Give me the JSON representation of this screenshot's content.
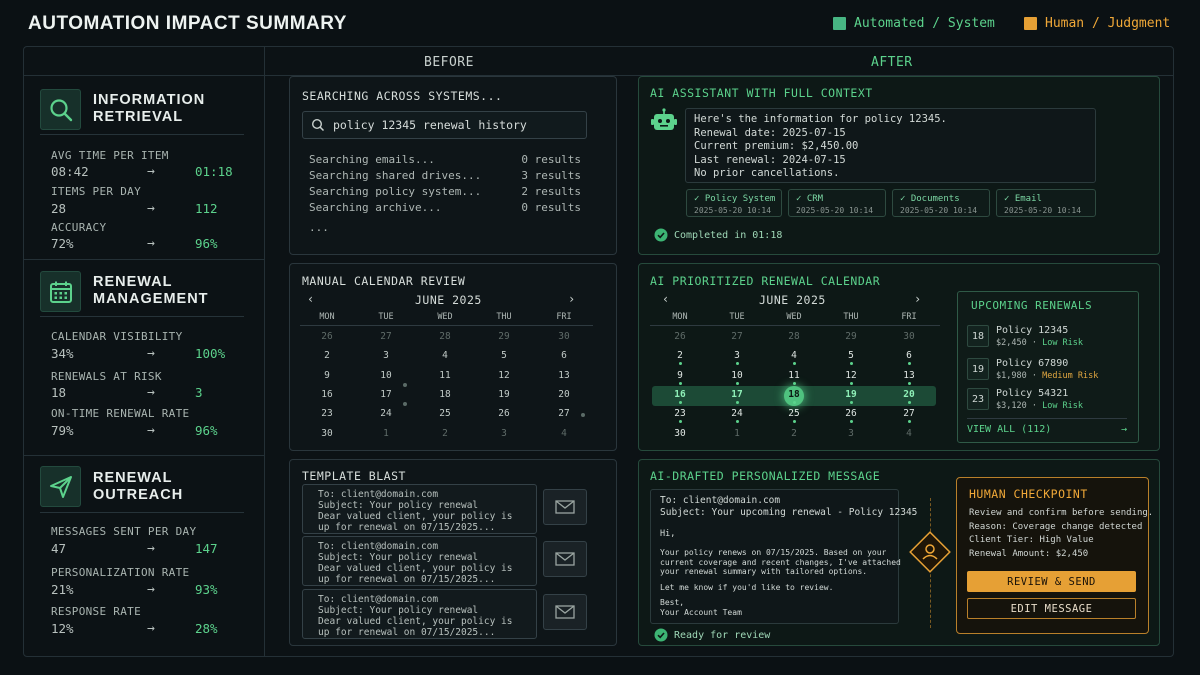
{
  "title": "AUTOMATION IMPACT SUMMARY",
  "legend": [
    {
      "label": "Automated / System",
      "color": "#47b583"
    },
    {
      "label": "Human / Judgment",
      "color": "#e6a035"
    }
  ],
  "columns": {
    "before": "BEFORE",
    "after": "AFTER"
  },
  "sections": [
    {
      "title_line1": "INFORMATION",
      "title_line2": "RETRIEVAL",
      "icon": "magnifier-icon",
      "metrics": [
        {
          "label": "AVG TIME PER ITEM",
          "before": "08:42",
          "after": "01:18"
        },
        {
          "label": "ITEMS PER DAY",
          "before": "28",
          "after": "112"
        },
        {
          "label": "ACCURACY",
          "before": "72%",
          "after": "96%"
        }
      ]
    },
    {
      "title_line1": "RENEWAL",
      "title_line2": "MANAGEMENT",
      "icon": "calendar-icon",
      "metrics": [
        {
          "label": "CALENDAR VISIBILITY",
          "before": "34%",
          "after": "100%"
        },
        {
          "label": "RENEWALS AT RISK",
          "before": "18",
          "after": "3"
        },
        {
          "label": "ON-TIME RENEWAL RATE",
          "before": "79%",
          "after": "96%"
        }
      ]
    },
    {
      "title_line1": "RENEWAL",
      "title_line2": "OUTREACH",
      "icon": "paper-plane-icon",
      "metrics": [
        {
          "label": "MESSAGES SENT PER DAY",
          "before": "47",
          "after": "147"
        },
        {
          "label": "PERSONALIZATION RATE",
          "before": "21%",
          "after": "93%"
        },
        {
          "label": "RESPONSE RATE",
          "before": "12%",
          "after": "28%"
        }
      ]
    }
  ],
  "arrow": "→",
  "search_panel": {
    "title": "SEARCHING ACROSS SYSTEMS...",
    "query": "policy 12345 renewal history",
    "rows": [
      {
        "label": "Searching emails...",
        "result": "0 results"
      },
      {
        "label": "Searching shared drives...",
        "result": "3 results"
      },
      {
        "label": "Searching policy system...",
        "result": "2 results"
      },
      {
        "label": "Searching archive...",
        "result": "0 results"
      }
    ],
    "ellipsis": "..."
  },
  "assistant_panel": {
    "title": "AI ASSISTANT WITH FULL CONTEXT",
    "lines": [
      "Here's the information for policy 12345.",
      "Renewal date: 2025-07-15",
      "Current premium: $2,450.00",
      "Last renewal: 2024-07-15",
      "No prior cancellations."
    ],
    "sources": [
      {
        "name": "Policy System",
        "time": "2025-05-20 10:14"
      },
      {
        "name": "CRM",
        "time": "2025-05-20 10:14"
      },
      {
        "name": "Documents",
        "time": "2025-05-20 10:14"
      },
      {
        "name": "Email",
        "time": "2025-05-20 10:14"
      }
    ],
    "status": "Completed in 01:18"
  },
  "manual_calendar": {
    "title": "MANUAL CALENDAR REVIEW",
    "month": "JUNE 2025",
    "days": [
      "MON",
      "TUE",
      "WED",
      "THU",
      "FRI"
    ],
    "weeks": [
      [
        "26",
        "27",
        "28",
        "29",
        "30"
      ],
      [
        "2",
        "3",
        "4",
        "5",
        "6"
      ],
      [
        "9",
        "10",
        "11",
        "12",
        "13"
      ],
      [
        "16",
        "17",
        "18",
        "19",
        "20"
      ],
      [
        "23",
        "24",
        "25",
        "26",
        "27"
      ],
      [
        "30",
        "1",
        "2",
        "3",
        "4"
      ]
    ]
  },
  "ai_calendar": {
    "title": "AI PRIORITIZED RENEWAL CALENDAR",
    "month": "JUNE 2025",
    "days": [
      "MON",
      "TUE",
      "WED",
      "THU",
      "FRI"
    ],
    "weeks": [
      [
        "26",
        "27",
        "28",
        "29",
        "30"
      ],
      [
        "2",
        "3",
        "4",
        "5",
        "6"
      ],
      [
        "9",
        "10",
        "11",
        "12",
        "13"
      ],
      [
        "16",
        "17",
        "18",
        "19",
        "20"
      ],
      [
        "23",
        "24",
        "25",
        "26",
        "27"
      ],
      [
        "30",
        "1",
        "2",
        "3",
        "4"
      ]
    ],
    "today": "18"
  },
  "upcoming": {
    "title": "UPCOMING RENEWALS",
    "items": [
      {
        "day": "18",
        "policy": "Policy 12345",
        "amount": "$2,450",
        "risk": "Low Risk",
        "risk_color": "#5cd28c"
      },
      {
        "day": "19",
        "policy": "Policy 67890",
        "amount": "$1,980",
        "risk": "Medium Risk",
        "risk_color": "#e0a640"
      },
      {
        "day": "23",
        "policy": "Policy 54321",
        "amount": "$3,120",
        "risk": "Low Risk",
        "risk_color": "#5cd28c"
      }
    ],
    "view_all": "VIEW ALL (112)"
  },
  "template_blast": {
    "title": "TEMPLATE BLAST",
    "email": "To: client@domain.com\nSubject: Your policy renewal\nDear valued client, your policy is\nup for renewal on 07/15/2025..."
  },
  "ai_message": {
    "title": "AI-DRAFTED PERSONALIZED MESSAGE",
    "header": "To: client@domain.com\nSubject: Your upcoming renewal - Policy 12345",
    "greeting": "Hi,",
    "body": "Your policy renews on 07/15/2025. Based on your\ncurrent coverage and recent changes, I've attached\nyour renewal summary with tailored options.",
    "closing_line": "Let me know if you'd like to review.",
    "signoff": "Best,\nYour Account Team",
    "status": "Ready for review"
  },
  "checkpoint": {
    "title": "HUMAN CHECKPOINT",
    "lines": [
      "Review and confirm before sending.",
      "Reason: Coverage change detected",
      "Client Tier: High Value",
      "Renewal Amount: $2,450"
    ],
    "primary_button": "REVIEW & SEND",
    "secondary_button": "EDIT MESSAGE"
  }
}
